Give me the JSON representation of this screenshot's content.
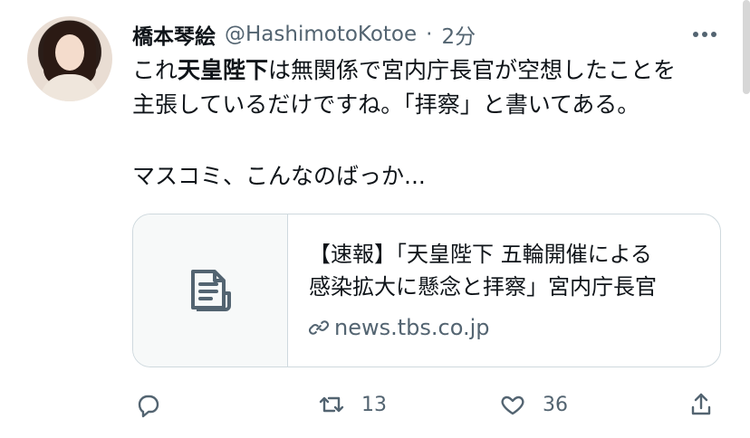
{
  "tweet": {
    "author_name": "橋本琴絵",
    "handle": "@HashimotoKotoe",
    "separator": "·",
    "time": "2分",
    "more_icon": "more-horizontal-icon",
    "lines": {
      "l1_before": "これ",
      "l1_bold": "天皇陛下",
      "l1_after": "は無関係で宮内庁長官が空想したことを",
      "l2": "主張しているだけですね。「拝察」と書いてある。",
      "l3": "マスコミ、こんなのばっか..."
    }
  },
  "card": {
    "icon": "document-icon",
    "title_line1": "【速報】「天皇陛下 五輪開催による",
    "title_line2": "感染拡大に懸念と拝察」宮内庁長官",
    "domain": "news.tbs.co.jp",
    "link_icon": "link-icon"
  },
  "actions": {
    "reply_icon": "reply-icon",
    "retweet_icon": "retweet-icon",
    "retweet_count": "13",
    "like_icon": "heart-icon",
    "like_count": "36",
    "share_icon": "share-icon"
  }
}
